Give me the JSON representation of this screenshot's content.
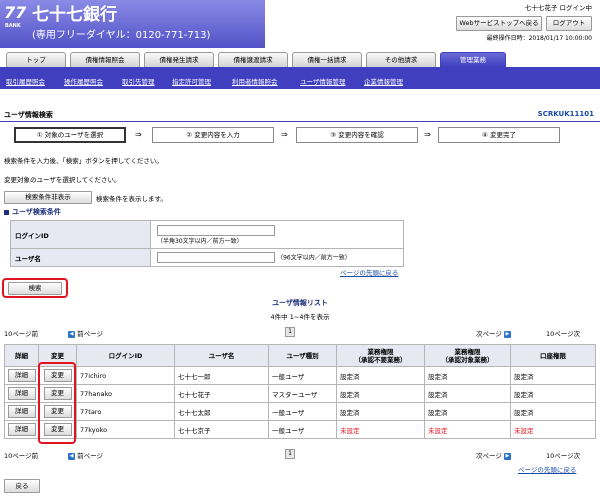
{
  "header": {
    "logo_number": "77",
    "logo_bank": "BANK",
    "bank_name": "七十七銀行",
    "hotline": "(専用フリーダイヤル：0120-771-713)",
    "user_status": "七十七花子 ログイン中",
    "web_top_button": "Webサービストップへ戻る",
    "logout_button": "ログアウト",
    "last_operation": "最終操作日時：2018/01/17 10:00:00"
  },
  "tabs": [
    "トップ",
    "債権情報照会",
    "債権発生請求",
    "債権譲渡請求",
    "債権一括請求",
    "その他請求",
    "管理業務"
  ],
  "subnav": [
    "取引履歴照会",
    "操作履歴照会",
    "取引先管理",
    "指定許可管理",
    "利用者情報照会",
    "ユーザ情報管理",
    "企業情報管理"
  ],
  "page": {
    "title": "ユーザ情報検索",
    "screen_id": "SCRKUK11101"
  },
  "steps": [
    "① 対象のユーザを選択",
    "② 変更内容を入力",
    "③ 変更内容を確認",
    "④ 変更完了"
  ],
  "messages": {
    "line1": "検索条件を入力後、「検索」ボタンを押してください。",
    "line2": "変更対象のユーザを選択してください。"
  },
  "conditions": {
    "hide_button": "検索条件非表示",
    "hide_text": "検索条件を表示します。",
    "section_title": "ユーザ検索条件",
    "login_label": "ログインID",
    "login_value": "",
    "login_hint": "（半角30文字以内／前方一致）",
    "user_label": "ユーザ名",
    "user_value": "",
    "user_hint": "（96文字以内／前方一致）",
    "page_top": "ページの先頭に戻る"
  },
  "search_button": "検索",
  "list": {
    "title": "ユーザ情報リスト",
    "count": "4件中 1~4件を表示",
    "prev10": "10ページ前",
    "prev": "前ページ",
    "page": "1",
    "next": "次ページ",
    "next10": "10ページ次",
    "page_top": "ページの先頭に戻る",
    "headers": [
      "詳細",
      "変更",
      "ログインID",
      "ユーザ名",
      "ユーザ種別",
      "業務権限\n（承認不要業務）",
      "業務権限\n（承認対象業務）",
      "口座権限"
    ],
    "detail_button": "詳細",
    "change_button": "変更",
    "rows": [
      {
        "login": "77ichiro",
        "name": "七十七一郎",
        "type": "一般ユーザ",
        "perm1": "設定済",
        "perm2": "設定済",
        "acct": "設定済",
        "unset": false
      },
      {
        "login": "77hanako",
        "name": "七十七花子",
        "type": "マスターユーザ",
        "perm1": "設定済",
        "perm2": "設定済",
        "acct": "設定済",
        "unset": false
      },
      {
        "login": "77taro",
        "name": "七十七太郎",
        "type": "一般ユーザ",
        "perm1": "設定済",
        "perm2": "設定済",
        "acct": "設定済",
        "unset": false
      },
      {
        "login": "77kyoko",
        "name": "七十七京子",
        "type": "一般ユーザ",
        "perm1": "未設定",
        "perm2": "未設定",
        "acct": "未設定",
        "unset": true
      }
    ]
  },
  "back_button": "戻る",
  "colors": {
    "brand": "#3f3fbf",
    "highlight": "#e0141e",
    "link": "#1a4aa6"
  }
}
